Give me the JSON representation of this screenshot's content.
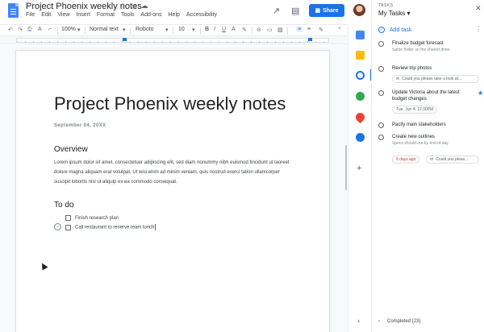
{
  "header": {
    "title": "Project Phoenix weekly notes",
    "menu": [
      "File",
      "Edit",
      "View",
      "Insert",
      "Format",
      "Tools",
      "Add-ons",
      "Help",
      "Accessibility"
    ],
    "share_label": "Share"
  },
  "toolbar": {
    "zoom": "100%",
    "style": "Normal text",
    "font": "Roboto",
    "font_size": "10"
  },
  "document": {
    "title": "Project Phoenix weekly notes",
    "date": "September 04, 20XX",
    "overview_heading": "Overview",
    "overview_body": "Lorem ipsum dolor sit amet, consectetuer adipiscing elit, sed diam nonummy nibh euismod tincidunt ut laoreet dolore magna aliquam erat volutpat. Ut wisi enim ad minim veniam, quis nostrud exerci tation ullamcorper suscipit lobortis nisl ut aliquip ex ea commodo consequat.",
    "todo_heading": "To do",
    "todos": [
      "Finish research plan",
      "Call restaurant to reserve team lunch"
    ]
  },
  "tasks_panel": {
    "label": "TASKS",
    "list_name": "My Tasks",
    "add_task_label": "Add task",
    "tasks": [
      {
        "title": "Finalize budget forecast",
        "note": "Same folder on the shared drive"
      },
      {
        "title": "Review trip photos",
        "chip": "Could you please take a look at..."
      },
      {
        "title": "Update Victoria about the latest budget changes",
        "date_chip": "Tue, Jun 4, 12:30PM"
      },
      {
        "title": "Pacify main stakeholders"
      },
      {
        "title": "Create new outlines",
        "note": "Specs should out by end of day",
        "overdue": "9 days ago",
        "chip": "Could you pleas..."
      }
    ],
    "completed_label": "Completed (23)"
  },
  "colors": {
    "accent": "#1a73e8",
    "overdue": "#d93025"
  }
}
